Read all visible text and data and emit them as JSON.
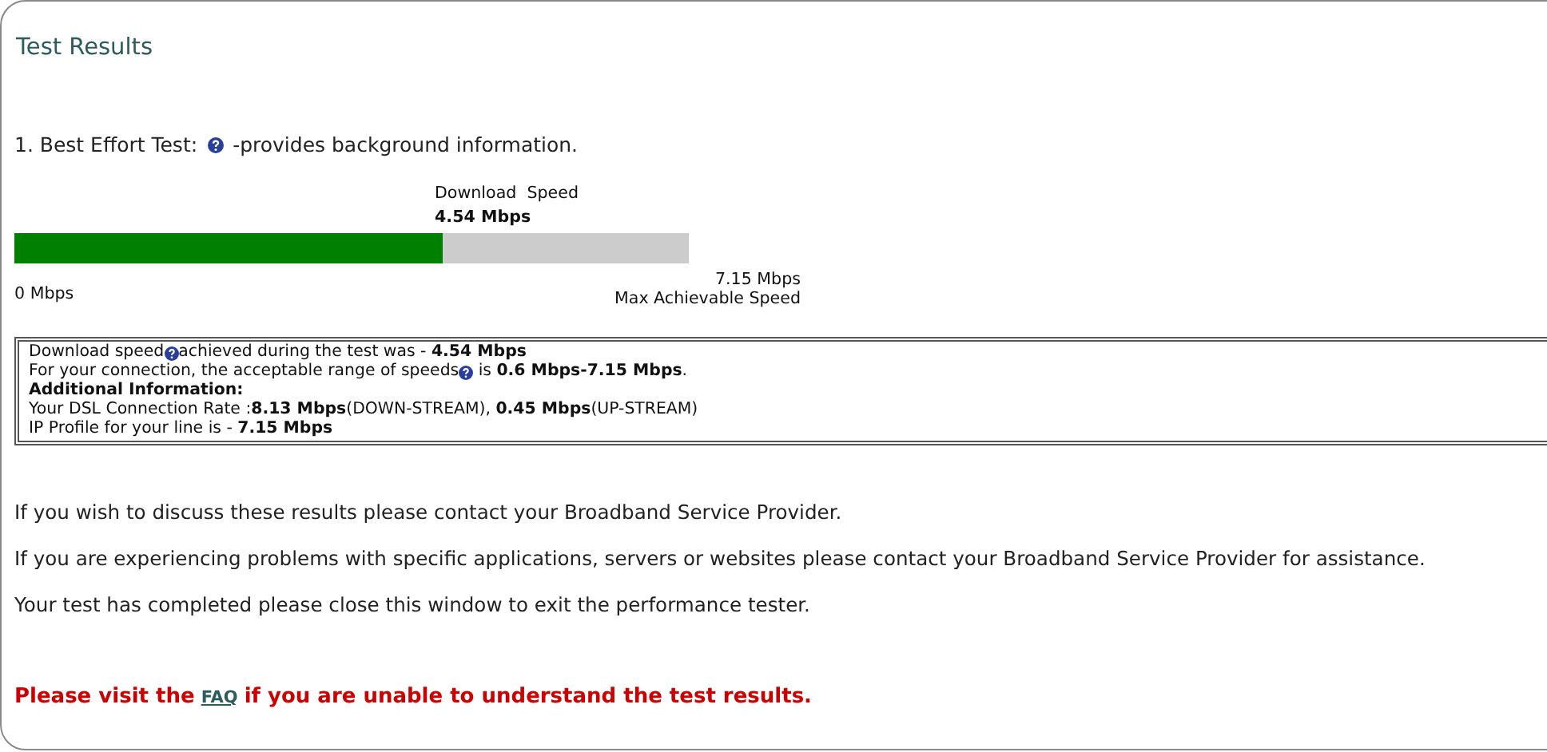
{
  "title": "Test Results",
  "test": {
    "parts": [
      {
        "kind": "text",
        "text": "1. Best Effort Test:"
      },
      {
        "kind": "help"
      },
      {
        "kind": "text",
        "text": "-provides background information."
      }
    ]
  },
  "meter": {
    "caption": "Download  Speed",
    "value": "4.54 Mbps",
    "level": 0.635,
    "min_label": "0 Mbps",
    "max_label": "7.15 Mbps",
    "max_caption": "Max Achievable Speed"
  },
  "info_box": {
    "lines": [
      {
        "kind": "text",
        "parts": [
          {
            "kind": "text",
            "text": "Download speed"
          },
          {
            "kind": "help"
          },
          {
            "kind": "text",
            "text": "achieved during the test was - **4.54 Mbps**"
          }
        ]
      },
      {
        "kind": "text",
        "parts": [
          {
            "kind": "text",
            "text": "For your connection, the acceptable range of speeds"
          },
          {
            "kind": "help"
          },
          {
            "kind": "text",
            "text": " is **0.6 Mbps-7.15 Mbps**."
          }
        ]
      },
      {
        "kind": "heading",
        "parts": [
          {
            "kind": "text",
            "text": "Additional Information:"
          }
        ]
      },
      {
        "kind": "text",
        "parts": [
          {
            "kind": "text",
            "text": "Your DSL Connection Rate :**8.13 Mbps**(DOWN-STREAM), **0.45 Mbps**(UP-STREAM)"
          }
        ]
      },
      {
        "kind": "text",
        "parts": [
          {
            "kind": "text",
            "text": "IP Profile for your line is - **7.15 Mbps**"
          }
        ]
      }
    ]
  },
  "paragraphs": [
    "If you wish to discuss these results please contact your Broadband Service Provider.",
    "If you are experiencing problems with specific applications, servers or websites please contact your Broadband Service Provider for assistance.",
    "Your test has completed please close this window to exit the performance tester."
  ],
  "notice": {
    "before": "Please visit the",
    "link": "FAQ",
    "after": "if you are unable to understand the test results."
  }
}
